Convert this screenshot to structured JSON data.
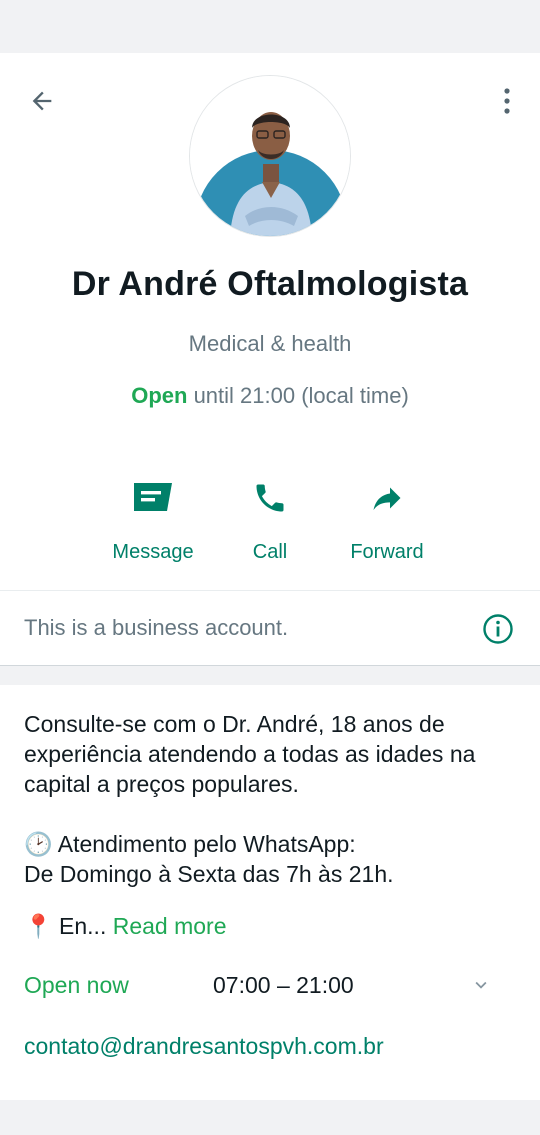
{
  "profile": {
    "name": "Dr André Oftalmologista",
    "category": "Medical & health",
    "status_open": "Open",
    "status_rest": " until 21:00 (local time)"
  },
  "actions": [
    {
      "label": "Message",
      "icon": "message-icon"
    },
    {
      "label": "Call",
      "icon": "phone-icon"
    },
    {
      "label": "Forward",
      "icon": "forward-icon"
    }
  ],
  "business_notice": {
    "text": "This is a business account.",
    "icon": "info-icon"
  },
  "about": {
    "line1": "Consulte-se com o Dr. André, 18 anos de experiência atendendo a todas as idades na capital a preços populares.",
    "line2": "🕑 Atendimento pelo WhatsApp:",
    "line3": "De Domingo à Sexta das 7h às 21h.",
    "line4_prefix": "📍 En...",
    "read_more": " Read more"
  },
  "hours": {
    "status": "Open now",
    "range": "07:00 – 21:00"
  },
  "contact": {
    "email": "contato@drandresantospvh.com.br"
  },
  "colors": {
    "accent_green": "#008069",
    "open_green": "#1fa855",
    "secondary_text": "#667781",
    "background": "#f1f2f4"
  }
}
